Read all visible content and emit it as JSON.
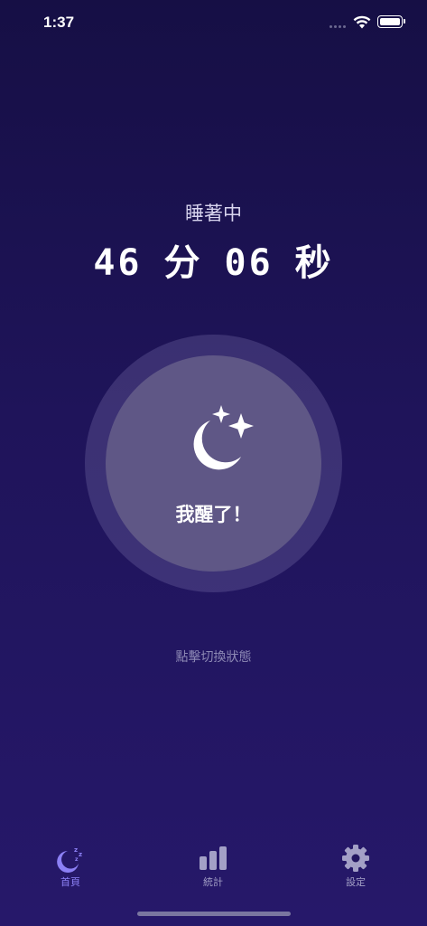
{
  "status_bar": {
    "time": "1:37"
  },
  "sleep": {
    "status_label": "睡著中",
    "minutes": "46",
    "minutes_unit": "分",
    "seconds": "06",
    "seconds_unit": "秒",
    "wake_button_label": "我醒了！",
    "wake_button_icon": "moon-stars-icon",
    "hint": "點擊切換狀態"
  },
  "tab_bar": {
    "tabs": [
      {
        "label": "首頁",
        "icon": "sleep-moon-icon",
        "active": true
      },
      {
        "label": "統計",
        "icon": "bar-chart-icon",
        "active": false
      },
      {
        "label": "設定",
        "icon": "gear-icon",
        "active": false
      }
    ]
  },
  "colors": {
    "background_top": "#160f45",
    "background_bottom": "#26186a",
    "button": "#5f5786",
    "active_tab": "#8c80f5",
    "inactive_tab": "#a3a0c6"
  }
}
